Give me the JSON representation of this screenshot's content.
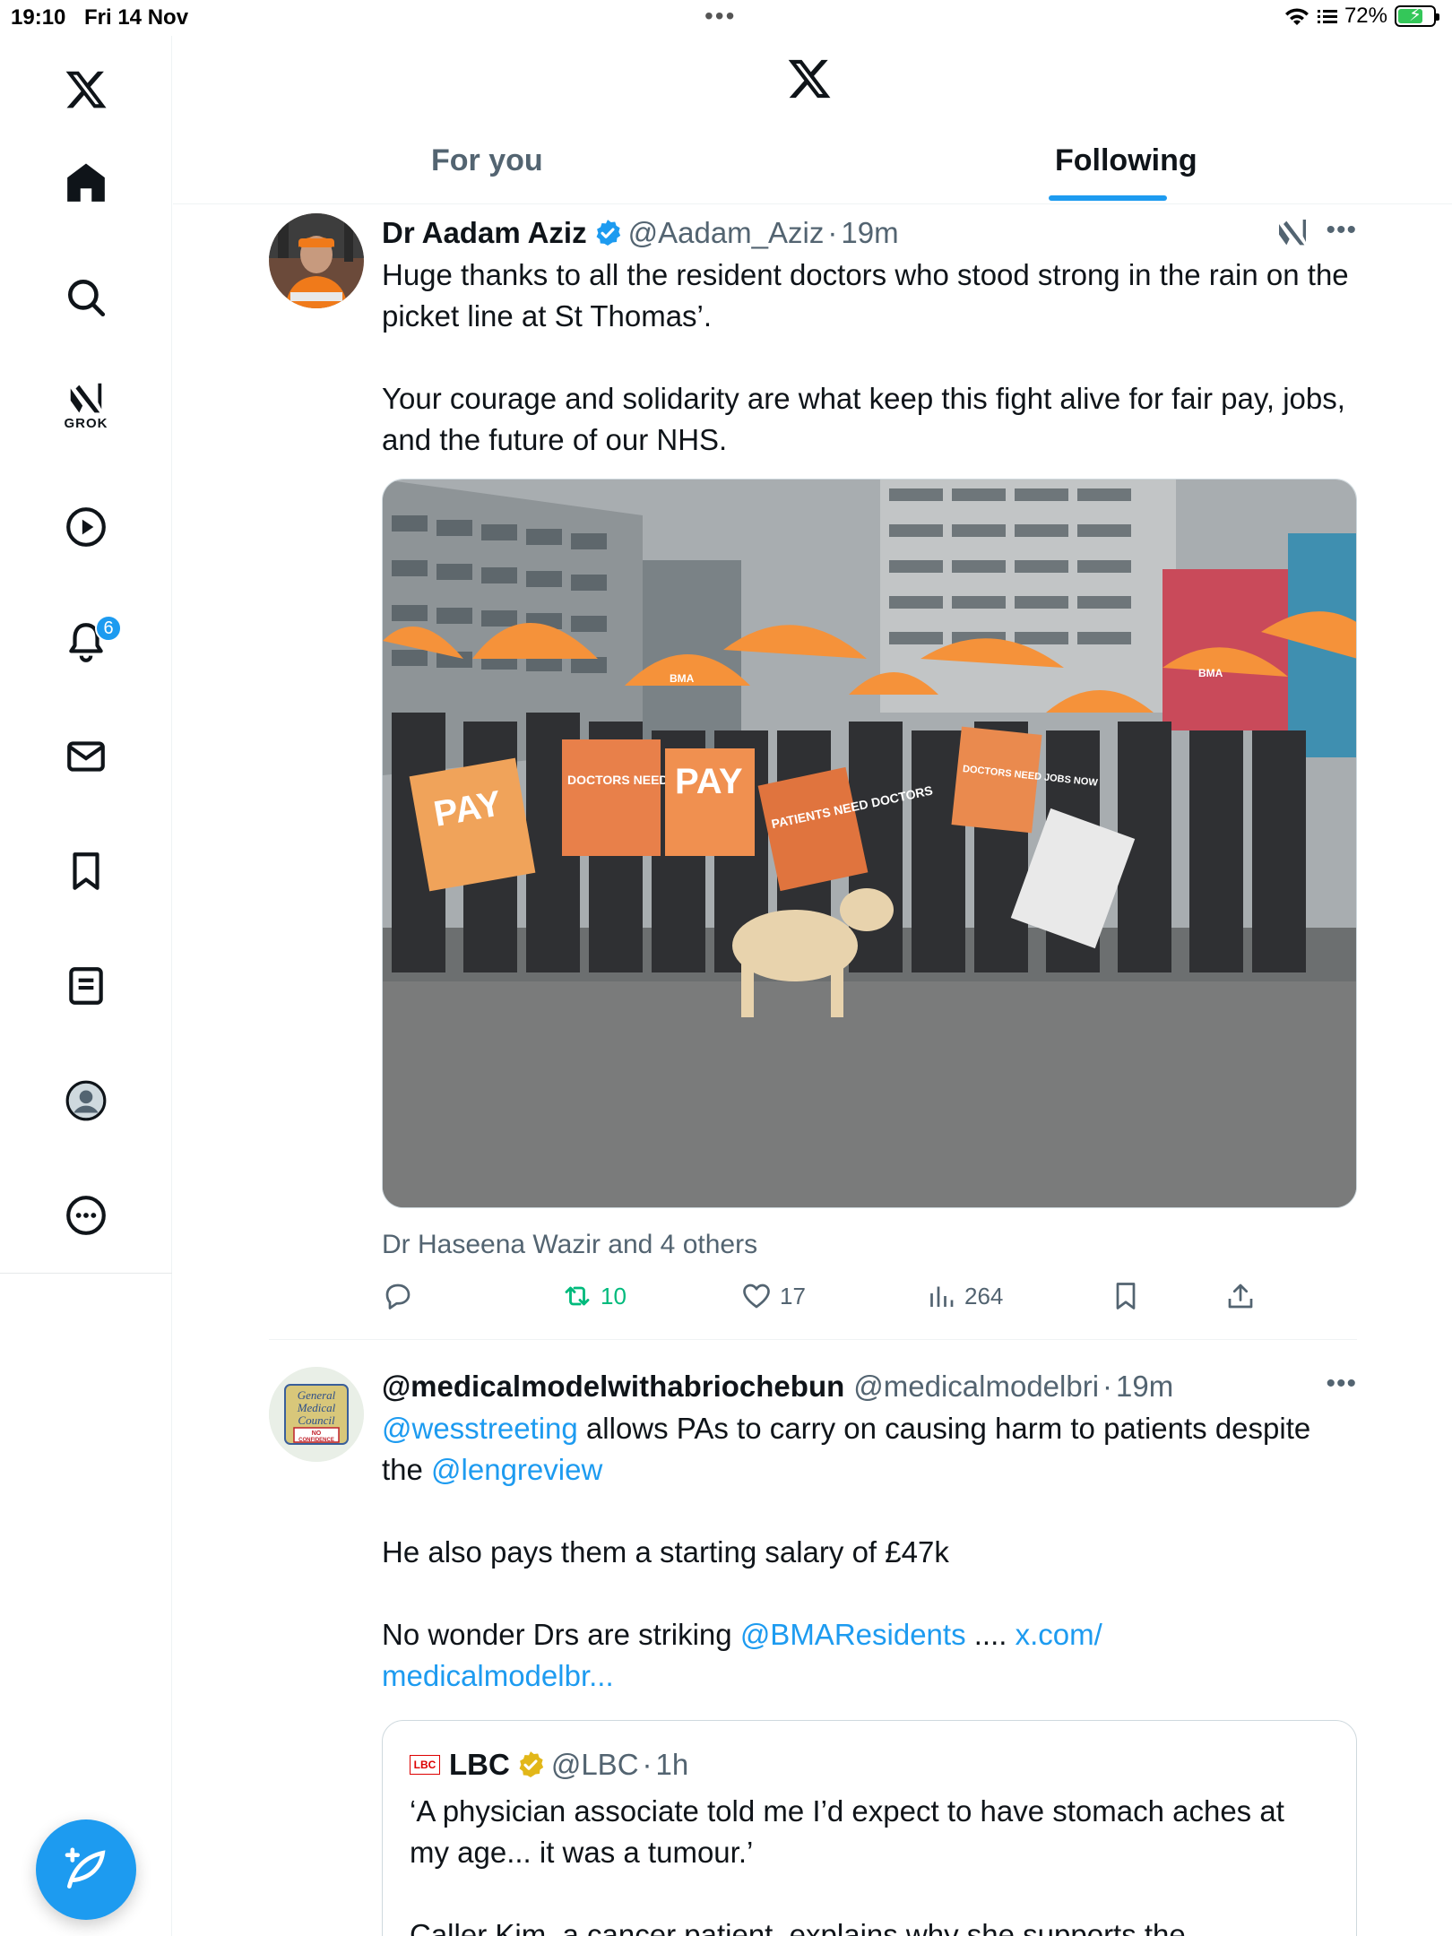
{
  "status_bar": {
    "time": "19:10",
    "date": "Fri 14 Nov",
    "battery": "72%",
    "battery_level": 0.72
  },
  "sidebar": {
    "items": [
      {
        "name": "x-logo-icon"
      },
      {
        "name": "home-icon"
      },
      {
        "name": "search-icon"
      },
      {
        "name": "grok-icon",
        "label": "GROK"
      },
      {
        "name": "video-icon"
      },
      {
        "name": "notifications-icon",
        "badge": "6"
      },
      {
        "name": "messages-icon"
      },
      {
        "name": "bookmarks-icon"
      },
      {
        "name": "lists-icon"
      },
      {
        "name": "profile-icon"
      },
      {
        "name": "more-icon"
      }
    ],
    "compose_icon": "compose-icon"
  },
  "header": {
    "tabs": [
      {
        "label": "For you",
        "active": false
      },
      {
        "label": "Following",
        "active": true
      }
    ]
  },
  "posts": [
    {
      "display_name": "Dr Aadam Aziz",
      "verified": true,
      "handle": "@Aadam_Aziz",
      "time": "19m",
      "text": "Huge thanks to all the resident doctors who stood strong in the rain on the picket line at St Thomas’.\n\nYour courage and solidarity are what keep this fight alive for fair pay, jobs, and the future of our NHS.",
      "media": {
        "signs": [
          "PAY",
          "DOCTORS NEED JOBS",
          "PATIENTS NEED DOCTORS",
          "PAY",
          "DOCTORS NEED JOBS NOW"
        ],
        "umbrella_text": "BMA"
      },
      "tagged": "Dr Haseena Wazir and 4 others",
      "stats": {
        "replies": "",
        "reposts": "10",
        "likes": "17",
        "views": "264"
      }
    },
    {
      "display_name": "@medicalmodelwithabriochebun",
      "handle": "@medicalmodelbri",
      "time": "19m",
      "avatar_text": [
        "General",
        "Medical",
        "Council",
        "NO",
        "CONFIDENCE"
      ],
      "text_mention_1": "@wesstreeting",
      "text_part_1": " allows PAs to carry on causing harm to patients despite the ",
      "text_mention_2": "@lengreview",
      "text_part_2": "He also pays them a starting salary of £47k",
      "text_part_3": "No wonder Drs are striking ",
      "text_mention_3": "@BMAResidents",
      "text_part_4": " .... ",
      "text_link": "x.com/\nmedicalmodelbr...",
      "quote": {
        "logo": "LBC",
        "display_name": "LBC",
        "handle": "@LBC",
        "time": "1h",
        "text": "‘A physician associate told me I’d expect to have stomach aches at my age... it was a tumour.’\n\nCaller Kim, a cancer patient, explains why she supports the"
      }
    }
  ],
  "colors": {
    "accent": "#1d9bf0",
    "repost": "#00ba7c",
    "secondary_text": "#536471"
  }
}
